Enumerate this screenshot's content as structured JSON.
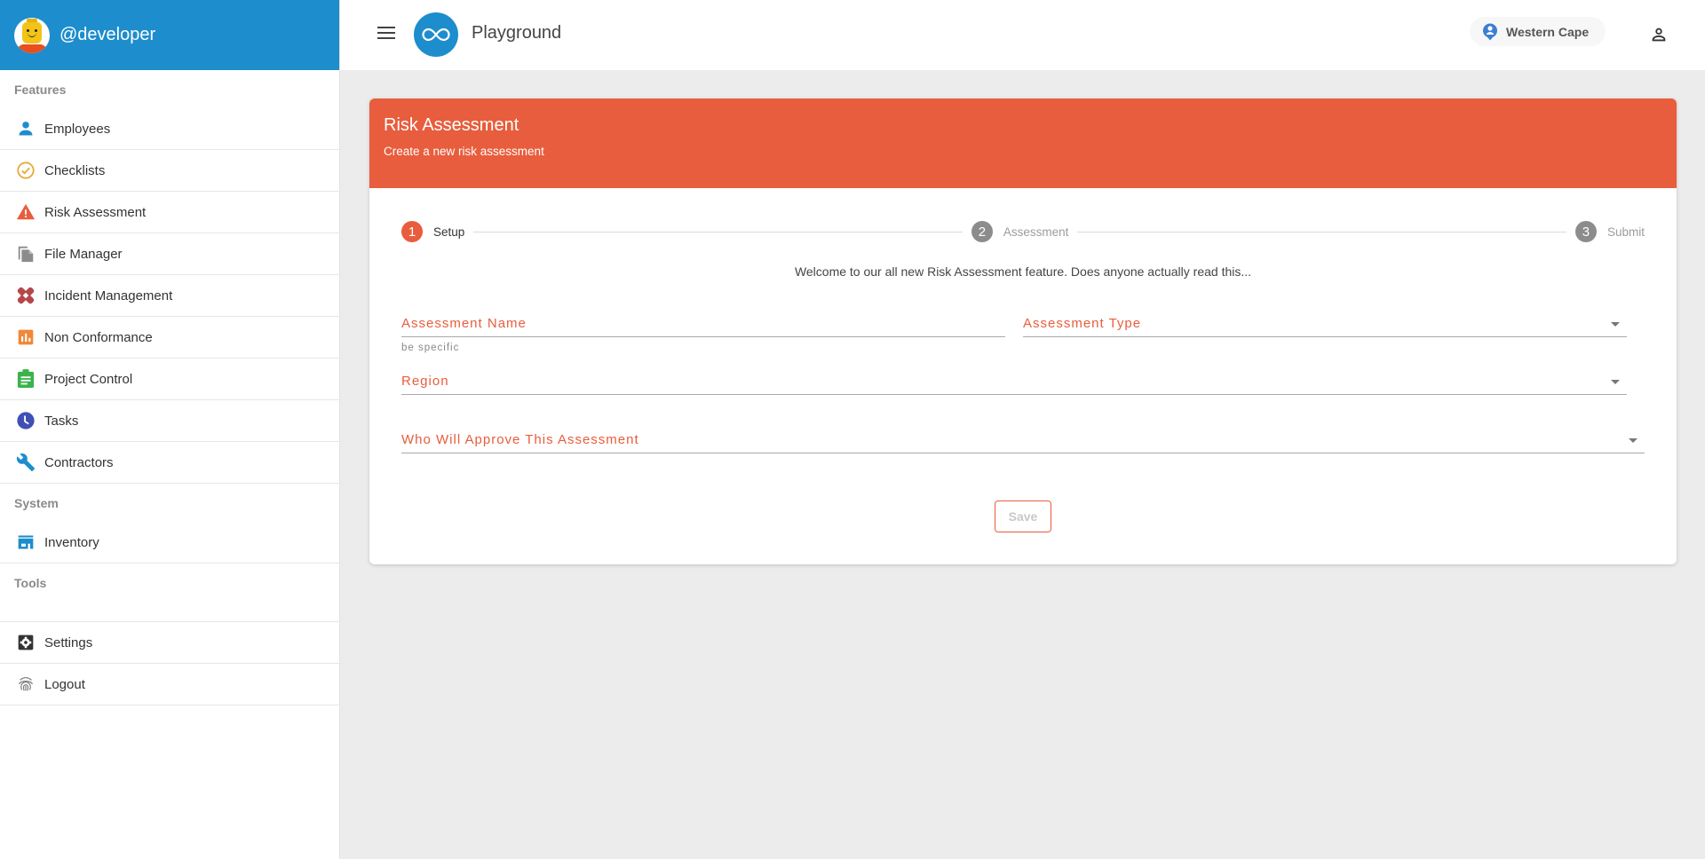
{
  "sidebar": {
    "username": "@developer",
    "sections": {
      "features": "Features",
      "system": "System",
      "tools": "Tools"
    },
    "items": [
      {
        "label": "Employees",
        "icon": "person-icon",
        "color": "#1d8dcd"
      },
      {
        "label": "Checklists",
        "icon": "check-circle-icon",
        "color": "#e8a93a"
      },
      {
        "label": "Risk Assessment",
        "icon": "warning-icon",
        "color": "#e85d3d"
      },
      {
        "label": "File Manager",
        "icon": "file-copy-icon",
        "color": "#8c8c8c"
      },
      {
        "label": "Incident Management",
        "icon": "bandage-icon",
        "color": "#b5474b"
      },
      {
        "label": "Non Conformance",
        "icon": "chart-icon",
        "color": "#f0883a"
      },
      {
        "label": "Project Control",
        "icon": "clipboard-icon",
        "color": "#3bb34a"
      },
      {
        "label": "Tasks",
        "icon": "clock-icon",
        "color": "#3f4fb5"
      },
      {
        "label": "Contractors",
        "icon": "wrench-icon",
        "color": "#1d8dcd"
      }
    ],
    "system_items": [
      {
        "label": "Inventory",
        "icon": "store-icon",
        "color": "#1d8dcd"
      }
    ],
    "tool_items": [
      {
        "label": "Settings",
        "icon": "settings-icon",
        "color": "#333333"
      },
      {
        "label": "Logout",
        "icon": "fingerprint-icon",
        "color": "#777777"
      }
    ]
  },
  "topbar": {
    "app_title": "Playground",
    "region": "Western Cape"
  },
  "card": {
    "title": "Risk Assessment",
    "subtitle": "Create a new risk assessment",
    "accent_color": "#e85d3d",
    "steps": [
      {
        "number": "1",
        "label": "Setup",
        "state": "active"
      },
      {
        "number": "2",
        "label": "Assessment",
        "state": "inactive"
      },
      {
        "number": "3",
        "label": "Submit",
        "state": "inactive"
      }
    ],
    "welcome": "Welcome to our all new Risk Assessment feature. Does anyone actually read this...",
    "fields": {
      "assessment_name": {
        "label": "Assessment Name",
        "value": "",
        "hint": "be specific"
      },
      "assessment_type": {
        "label": "Assessment Type",
        "value": ""
      },
      "region": {
        "label": "Region",
        "value": ""
      },
      "approver": {
        "label": "Who Will Approve This Assessment",
        "value": ""
      }
    },
    "save_label": "Save"
  }
}
